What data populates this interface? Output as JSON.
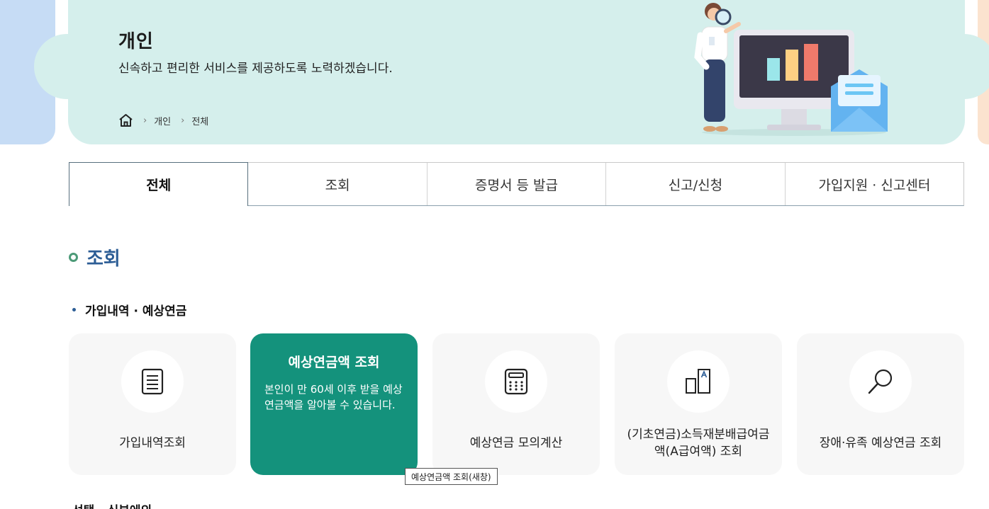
{
  "hero": {
    "title": "개인",
    "subtitle": "신속하고 편리한 서비스를 제공하도록 노력하겠습니다.",
    "breadcrumb": [
      "개인",
      "전체"
    ]
  },
  "tabs": [
    {
      "label": "전체",
      "active": true
    },
    {
      "label": "조회",
      "active": false
    },
    {
      "label": "증명서 등 발급",
      "active": false
    },
    {
      "label": "신고/신청",
      "active": false
    },
    {
      "label": "가입지원 · 신고센터",
      "active": false
    }
  ],
  "section": {
    "title": "조회",
    "subsection": "가입내역 · 예상연금"
  },
  "cards": [
    {
      "label": "가입내역조회",
      "icon": "document-icon"
    },
    {
      "title": "예상연금액 조회",
      "desc": "본인이 만 60세 이후 받을 예상연금액을 알아볼 수 있습니다.",
      "icon": "none",
      "active": true
    },
    {
      "label": "예상연금 모의계산",
      "icon": "calculator-icon"
    },
    {
      "label": "(기초연금)소득재분배급여금액(A급여액) 조회",
      "icon": "a-value-icon"
    },
    {
      "label": "장애·유족 예상연금 조회",
      "icon": "magnifier-icon"
    }
  ],
  "tooltip": "예상연금액 조회(새창)",
  "next_section": "선택 · 심부에의"
}
